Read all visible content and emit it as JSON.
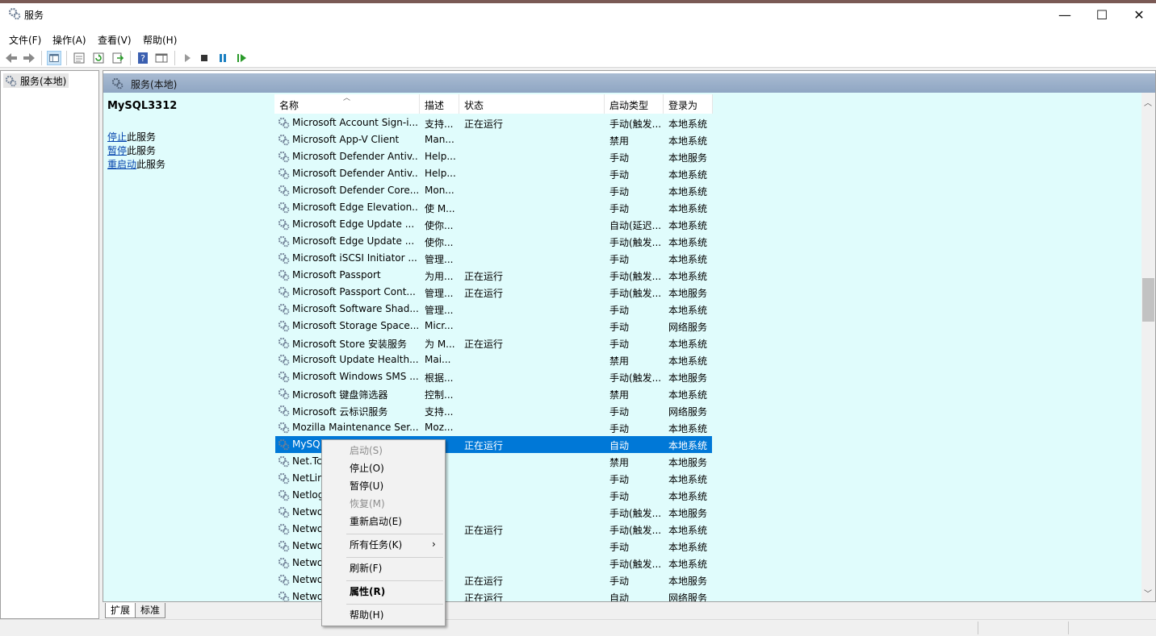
{
  "window": {
    "title": "服务",
    "minimize": "—",
    "maximize": "☐",
    "close": "✕"
  },
  "menu": [
    "文件(F)",
    "操作(A)",
    "查看(V)",
    "帮助(H)"
  ],
  "toolbar": {
    "icons": [
      "back-icon",
      "forward-icon",
      "show-hide-tree-icon",
      "properties-icon",
      "refresh-icon",
      "export-icon",
      "help-icon",
      "show-action-pane-icon",
      "start-service-icon",
      "stop-service-icon",
      "pause-service-icon",
      "resume-service-icon"
    ]
  },
  "tree": {
    "item": "服务(本地)"
  },
  "pane": {
    "header": "服务(本地)"
  },
  "details": {
    "service_name": "MySQL3312",
    "stop_link": "停止",
    "stop_suffix": "此服务",
    "pause_link": "暂停",
    "pause_suffix": "此服务",
    "restart_link": "重启动",
    "restart_suffix": "此服务"
  },
  "columns": [
    "名称",
    "描述",
    "状态",
    "启动类型",
    "登录为"
  ],
  "rows": [
    [
      "Microsoft Account Sign-i...",
      "支持...",
      "正在运行",
      "手动(触发...",
      "本地系统"
    ],
    [
      "Microsoft App-V Client",
      "Man...",
      "",
      "禁用",
      "本地系统"
    ],
    [
      "Microsoft Defender Antiv...",
      "Help...",
      "",
      "手动",
      "本地服务"
    ],
    [
      "Microsoft Defender Antiv...",
      "Help...",
      "",
      "手动",
      "本地系统"
    ],
    [
      "Microsoft Defender Core...",
      "Mon...",
      "",
      "手动",
      "本地系统"
    ],
    [
      "Microsoft Edge Elevation...",
      "使 M...",
      "",
      "手动",
      "本地系统"
    ],
    [
      "Microsoft Edge Update ...",
      "使你...",
      "",
      "自动(延迟...",
      "本地系统"
    ],
    [
      "Microsoft Edge Update ...",
      "使你...",
      "",
      "手动(触发...",
      "本地系统"
    ],
    [
      "Microsoft iSCSI Initiator ...",
      "管理...",
      "",
      "手动",
      "本地系统"
    ],
    [
      "Microsoft Passport",
      "为用...",
      "正在运行",
      "手动(触发...",
      "本地系统"
    ],
    [
      "Microsoft Passport Cont...",
      "管理...",
      "正在运行",
      "手动(触发...",
      "本地服务"
    ],
    [
      "Microsoft Software Shad...",
      "管理...",
      "",
      "手动",
      "本地系统"
    ],
    [
      "Microsoft Storage Space...",
      "Micr...",
      "",
      "手动",
      "网络服务"
    ],
    [
      "Microsoft Store 安装服务",
      "为 M...",
      "正在运行",
      "手动",
      "本地系统"
    ],
    [
      "Microsoft Update Health...",
      "Mai...",
      "",
      "禁用",
      "本地系统"
    ],
    [
      "Microsoft Windows SMS ...",
      "根据...",
      "",
      "手动(触发...",
      "本地服务"
    ],
    [
      "Microsoft 键盘筛选器",
      "控制...",
      "",
      "禁用",
      "本地系统"
    ],
    [
      "Microsoft 云标识服务",
      "支持...",
      "",
      "手动",
      "网络服务"
    ],
    [
      "Mozilla Maintenance Ser...",
      "Moz...",
      "",
      "手动",
      "本地系统"
    ],
    [
      "MySQ",
      "",
      "正在运行",
      "自动",
      "本地系统"
    ],
    [
      "Net.Tc",
      "...",
      "",
      "禁用",
      "本地服务"
    ],
    [
      "NetLin",
      "...",
      "",
      "手动",
      "本地系统"
    ],
    [
      "Netlog",
      "...",
      "",
      "手动",
      "本地系统"
    ],
    [
      "Netwo",
      "...",
      "",
      "手动(触发...",
      "本地服务"
    ],
    [
      "Netwo",
      "...",
      "正在运行",
      "手动(触发...",
      "本地系统"
    ],
    [
      "Netwo",
      "...",
      "",
      "手动",
      "本地系统"
    ],
    [
      "Netwo",
      "...",
      "",
      "手动(触发...",
      "本地系统"
    ],
    [
      "Netwo",
      "...",
      "正在运行",
      "手动",
      "本地服务"
    ],
    [
      "Netwo",
      "...",
      "正在运行",
      "自动",
      "网络服务"
    ]
  ],
  "selected_row": 19,
  "tabs": [
    "扩展",
    "标准"
  ],
  "context_menu": {
    "start": "启动(S)",
    "stop": "停止(O)",
    "pause": "暂停(U)",
    "resume": "恢复(M)",
    "restart": "重新启动(E)",
    "all_tasks": "所有任务(K)",
    "refresh": "刷新(F)",
    "properties": "属性(R)",
    "help": "帮助(H)"
  },
  "colors": {
    "list_bg": "#e0fcfc",
    "selection": "#0078d7",
    "header_gradient": "#a9bbd2"
  }
}
